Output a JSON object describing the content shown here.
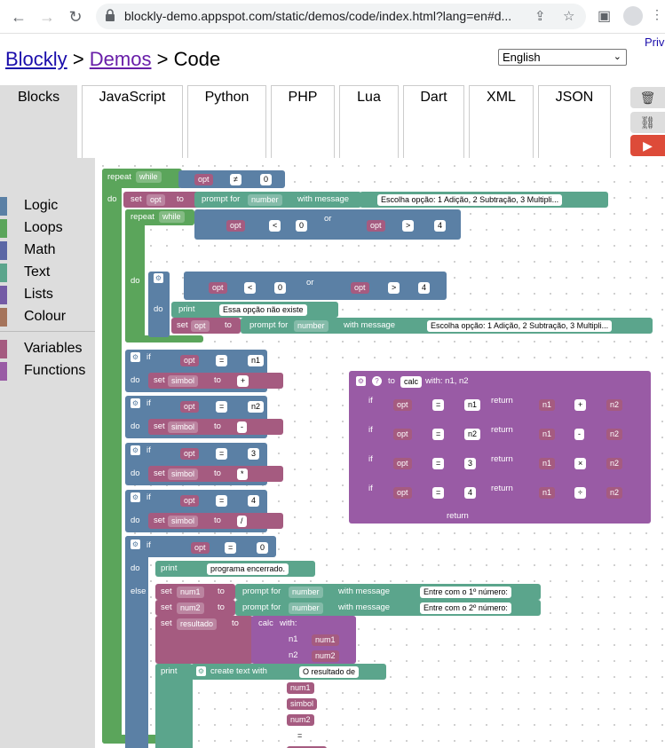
{
  "browser": {
    "url": "blockly-demo.appspot.com/static/demos/code/index.html?lang=en#d...",
    "back_icon": "back-arrow-icon",
    "forward_icon": "forward-arrow-icon",
    "reload_icon": "reload-icon"
  },
  "page": {
    "priv_link": "Priv",
    "breadcrumb": {
      "blockly": "Blockly",
      "sep1": ">",
      "demos": "Demos",
      "sep2": ">",
      "current": "Code"
    },
    "language_select": "English",
    "tabs": [
      "Blocks",
      "JavaScript",
      "Python",
      "PHP",
      "Lua",
      "Dart",
      "XML",
      "JSON"
    ],
    "toolbox": [
      {
        "label": "Logic",
        "color": "#5b80a5"
      },
      {
        "label": "Loops",
        "color": "#5ba55b"
      },
      {
        "label": "Math",
        "color": "#5b67a5"
      },
      {
        "label": "Text",
        "color": "#5ba58c"
      },
      {
        "label": "Lists",
        "color": "#745ba5"
      },
      {
        "label": "Colour",
        "color": "#a5745b"
      },
      {
        "label": "Variables",
        "color": "#a55b80"
      },
      {
        "label": "Functions",
        "color": "#995ba5"
      }
    ]
  },
  "blocks": {
    "repeat": "repeat",
    "while": "while",
    "do": "do",
    "opt": "opt",
    "neq": "≠",
    "lt": "<",
    "gt": ">",
    "eq": "=",
    "n0": "0",
    "n4": "4",
    "n1": "n1",
    "n2": "n2",
    "n3": "3",
    "or": "or",
    "if": "if",
    "set": "set",
    "to": "to",
    "prompt_for": "prompt for",
    "number": "number",
    "with_message": "with message",
    "msg_menu": "Escolha opção: 1 Adição, 2 Subtração, 3 Multipli...",
    "print": "print",
    "msg_invalid": "Essa opção não existe",
    "simbol": "simbol",
    "plus": "+",
    "minus": "-",
    "times": "*",
    "div": "/",
    "times_op": "×",
    "div_op": "÷",
    "msg_end": "programa encerrado.",
    "else": "else",
    "num1": "num1",
    "num2": "num2",
    "resultado": "resultado",
    "msg_num1": "Entre com o 1º número:",
    "msg_num2": "Entre com o 2º número:",
    "calc": "calc",
    "with": "with:",
    "create_text": "create text with",
    "msg_result": "O resultado de",
    "eq_text": "=",
    "to_label": "to",
    "calc_def": "calc",
    "with_params": "with: n1, n2",
    "return": "return"
  }
}
